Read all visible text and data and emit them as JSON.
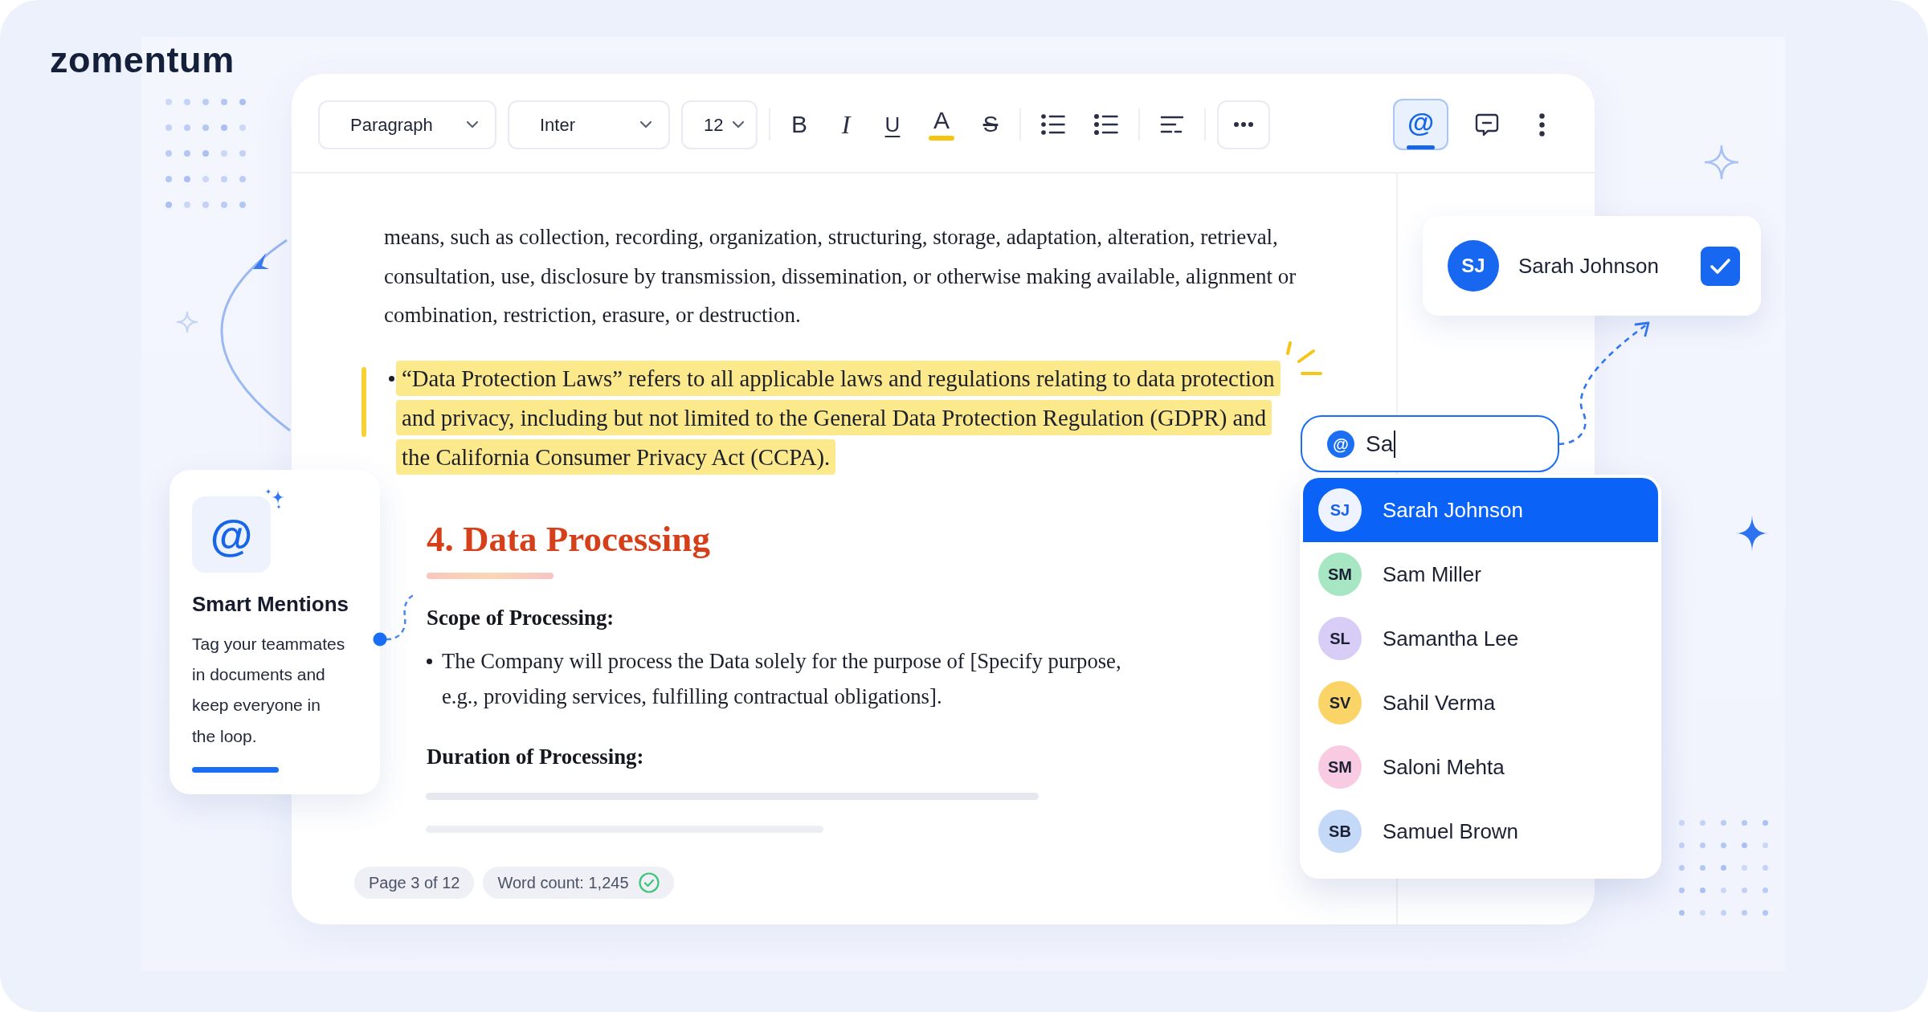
{
  "logo": {
    "text": "zomentum"
  },
  "toolbar": {
    "selects": [
      {
        "value": "Paragraph"
      },
      {
        "value": "Inter"
      },
      {
        "value": "12"
      }
    ],
    "format_buttons": [
      {
        "kind": "bold",
        "label": "B"
      },
      {
        "kind": "italic",
        "label": "I"
      },
      {
        "kind": "underline",
        "label": "U"
      },
      {
        "kind": "text-color",
        "label": "A"
      },
      {
        "kind": "strikethrough",
        "label": "S"
      }
    ],
    "mention_button": {
      "label": "@",
      "active": true
    }
  },
  "document": {
    "intro": "means, such as collection, recording, organization, structuring, storage, adaptation, alteration, retrieval, consultation, use, disclosure by transmission, dissemination, or otherwise making available, alignment or combination, restriction, erasure, or destruction.",
    "definition": {
      "text": "“Data Protection Laws” refers to all applicable laws and regulations relating to data protection and privacy, including but not limited to the General Data Protection Regulation (GDPR) and the California Consumer Privacy Act (CCPA).",
      "highlighted": true
    },
    "section_heading": "4. Data Processing",
    "subsections": [
      {
        "heading": "Scope of Processing:",
        "bullets": [
          "The Company will process the Data solely for the purpose of [Specify purpose, e.g., providing services, fulfilling contractual obligations]."
        ]
      },
      {
        "heading": "Duration of Processing:"
      }
    ]
  },
  "status_bar": {
    "page": "Page 3 of 12",
    "word_count": "Word count: 1,245"
  },
  "feature_card": {
    "icon": "@",
    "title": "Smart Mentions",
    "description": "Tag your teammates in documents and keep everyone in the loop."
  },
  "assignee_card": {
    "initials": "SJ",
    "name": "Sarah Johnson",
    "checked": true
  },
  "mention_search": {
    "prefix": "@",
    "value": "Sa",
    "focused": true
  },
  "mention_options": [
    {
      "initials": "SJ",
      "name": "Sarah Johnson",
      "color": "#eef3ff",
      "selected": true
    },
    {
      "initials": "SM",
      "name": "Sam Miller",
      "color": "#a6e6c3",
      "selected": false
    },
    {
      "initials": "SL",
      "name": "Samantha Lee",
      "color": "#d8cdf6",
      "selected": false
    },
    {
      "initials": "SV",
      "name": "Sahil Verma",
      "color": "#fbd468",
      "selected": false
    },
    {
      "initials": "SM",
      "name": "Saloni Mehta",
      "color": "#f9cbe3",
      "selected": false
    },
    {
      "initials": "SB",
      "name": "Samuel Brown",
      "color": "#c4d9f8",
      "selected": false
    }
  ]
}
